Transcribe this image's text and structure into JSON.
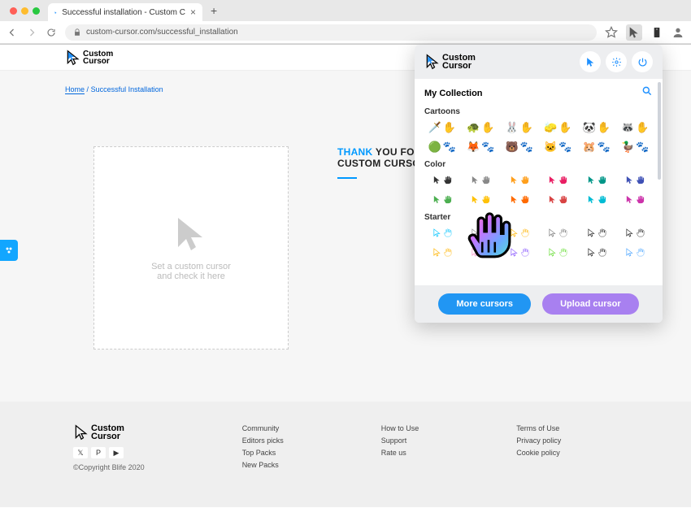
{
  "browser": {
    "tab_title": "Successful installation - Custom C",
    "url": "custom-cursor.com/successful_installation",
    "newtab": "+",
    "close": "×"
  },
  "logo": {
    "top": "Custom",
    "bottom": "Cursor"
  },
  "breadcrumb": {
    "home": "Home",
    "sep": "/",
    "current": "Successful Installation"
  },
  "tryzone": {
    "line1": "Set a custom cursor",
    "line2": "and check it here"
  },
  "thanks": {
    "t1": "THANK",
    "t2": "YOU FOR INSTALLING",
    "t3": "CUSTOM CURSOR"
  },
  "footer": {
    "copy": "©Copyright Blife 2020",
    "col1": [
      "Community",
      "Editors picks",
      "Top Packs",
      "New Packs"
    ],
    "col2": [
      "How to Use",
      "Support",
      "Rate us"
    ],
    "col3": [
      "Terms of Use",
      "Privacy policy",
      "Cookie policy"
    ]
  },
  "popup": {
    "collection": "My Collection",
    "sections": {
      "cartoons": "Cartoons",
      "color": "Color",
      "starter": "Starter"
    },
    "colors_row1": [
      "#333",
      "#888",
      "#ff9f1c",
      "#e91e63",
      "#009688",
      "#3f51b5"
    ],
    "colors_row2": [
      "#4caf50",
      "#ffc107",
      "#ff6a00",
      "#d84343",
      "#00bcd4",
      "#cc33aa"
    ],
    "cartoons_row1": [
      "🗡️",
      "🐢",
      "🐰",
      "🧽",
      "🐼",
      "🦝"
    ],
    "cartoons_row2": [
      "🟢",
      "🦊",
      "🐻",
      "🐱",
      "🐹",
      "🦆"
    ],
    "more": "More cursors",
    "upload": "Upload cursor"
  }
}
